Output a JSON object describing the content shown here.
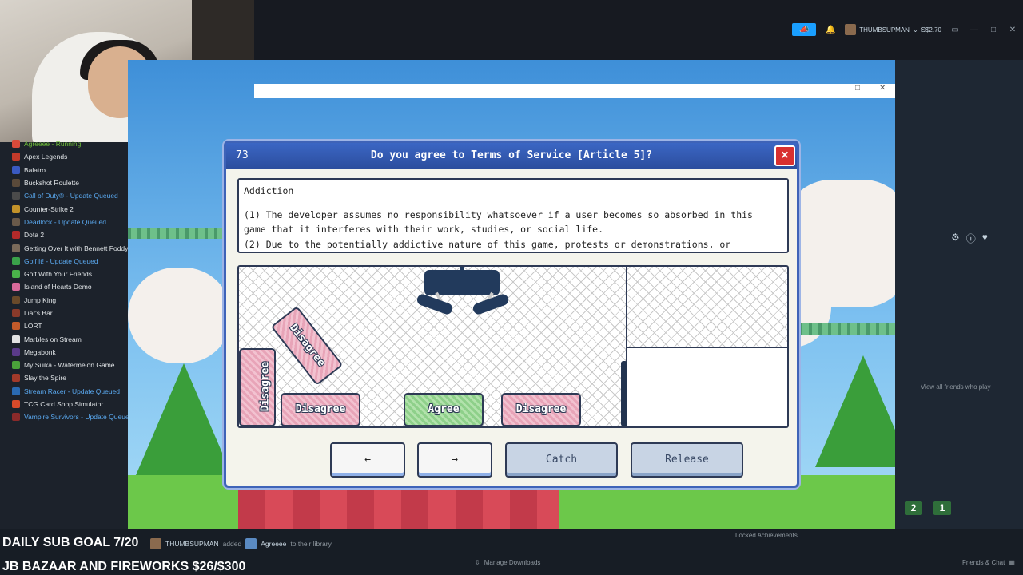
{
  "topbar": {
    "user": "THUMBSUPMAN",
    "balance": "S$2.70",
    "announce_icon": "megaphone-icon",
    "bell_icon": "bell-icon"
  },
  "library": {
    "items": [
      {
        "label": "Agreeee - Running",
        "state": "running",
        "color": "#d84a3a"
      },
      {
        "label": "Apex Legends",
        "state": "normal",
        "color": "#c23a2a"
      },
      {
        "label": "Balatro",
        "state": "normal",
        "color": "#3a5ac2"
      },
      {
        "label": "Buckshot Roulette",
        "state": "normal",
        "color": "#5a4a3a"
      },
      {
        "label": "Call of Duty® - Update Queued",
        "state": "queued",
        "color": "#4a4a4a"
      },
      {
        "label": "Counter-Strike 2",
        "state": "normal",
        "color": "#c2922a"
      },
      {
        "label": "Deadlock - Update Queued",
        "state": "queued",
        "color": "#6a5a4a"
      },
      {
        "label": "Dota 2",
        "state": "normal",
        "color": "#b22a2a"
      },
      {
        "label": "Getting Over It with Bennett Foddy",
        "state": "normal",
        "color": "#7a6a5a"
      },
      {
        "label": "Golf It! - Update Queued",
        "state": "queued",
        "color": "#3aa24a"
      },
      {
        "label": "Golf With Your Friends",
        "state": "normal",
        "color": "#4ab24a"
      },
      {
        "label": "Island of Hearts Demo",
        "state": "normal",
        "color": "#d86a9a"
      },
      {
        "label": "Jump King",
        "state": "normal",
        "color": "#6a4a2a"
      },
      {
        "label": "Liar's Bar",
        "state": "normal",
        "color": "#8a3a2a"
      },
      {
        "label": "LORT",
        "state": "normal",
        "color": "#c25a2a"
      },
      {
        "label": "Marbles on Stream",
        "state": "normal",
        "color": "#e2e2e2"
      },
      {
        "label": "Megabonk",
        "state": "normal",
        "color": "#5a3a8a"
      },
      {
        "label": "My Suika - Watermelon Game",
        "state": "normal",
        "color": "#4aa23a"
      },
      {
        "label": "Slay the Spire",
        "state": "normal",
        "color": "#a23a2a"
      },
      {
        "label": "Stream Racer - Update Queued",
        "state": "queued",
        "color": "#2a6ab2"
      },
      {
        "label": "TCG Card Shop Simulator",
        "state": "normal",
        "color": "#d84a2a"
      },
      {
        "label": "Vampire Survivors - Update Queued",
        "state": "queued",
        "color": "#8a2a2a"
      }
    ]
  },
  "dialog": {
    "number": "73",
    "title": "Do you agree to Terms of Service [Article 5]?",
    "close_label": "×",
    "tos_heading": "Addiction",
    "tos_line1": "(1) The developer assumes no responsibility whatsoever if a user becomes so absorbed in this",
    "tos_line2": "game that it interferes with their work,  studies,  or social life.",
    "tos_line3": "(2) Due to the potentially addictive nature of this game,  protests or demonstrations,  or",
    "blocks": {
      "disagree": "Disagree",
      "agree": "Agree"
    },
    "buttons": {
      "left": "←",
      "right": "→",
      "catch": "Catch",
      "release": "Release"
    }
  },
  "right_panel": {
    "friends_text": "View all friends who play",
    "badge_a": "2",
    "badge_b": "1"
  },
  "bottom": {
    "goal_line1": "DAILY SUB GOAL 7/20",
    "goal_line2": "JB BAZAAR AND FIREWORKS $26/$300",
    "notif_user": "THUMBSUPMAN",
    "notif_mid": "added",
    "notif_game": "Agreeee",
    "notif_end": "to their library",
    "locked_achievements": "Locked Achievements",
    "manage_downloads": "Manage Downloads",
    "friends_chat": "Friends & Chat"
  }
}
